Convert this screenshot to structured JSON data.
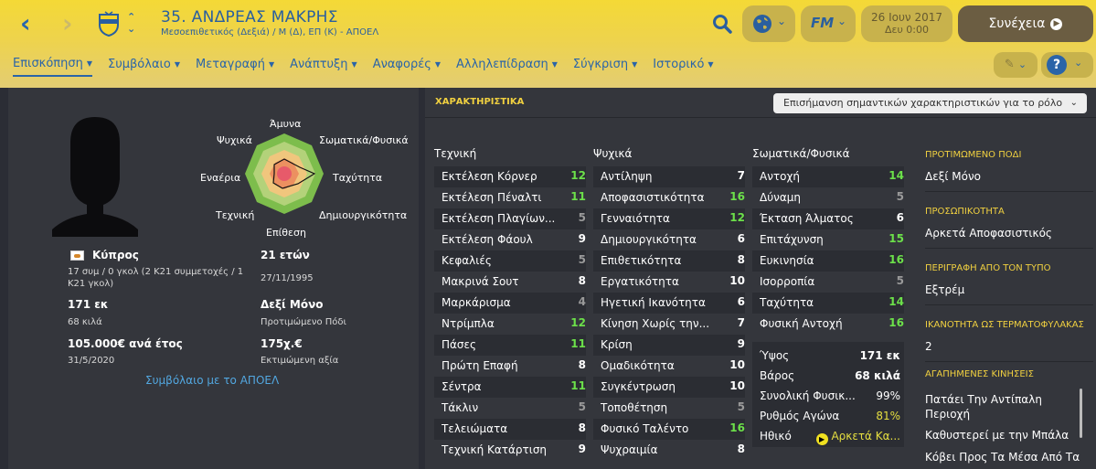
{
  "header": {
    "player_name": "35. ΑΝΔΡΕΑΣ ΜΑΚΡΗΣ",
    "player_desc": "Μεσοεπιθετικός (Δεξιά) / Μ (Δ), ΕΠ (Κ) - ΑΠΟΕΛ",
    "date": "26 Ιουν 2017",
    "time": "Δευ 0:00",
    "continue_label": "Συνέχεια",
    "fm_label": "FM"
  },
  "tabs": [
    {
      "label": "Επισκόπηση"
    },
    {
      "label": "Συμβόλαιο"
    },
    {
      "label": "Μεταγραφή"
    },
    {
      "label": "Ανάπτυξη"
    },
    {
      "label": "Αναφορές"
    },
    {
      "label": "Αλληλεπίδραση"
    },
    {
      "label": "Σύγκριση"
    },
    {
      "label": "Ιστορικό"
    }
  ],
  "radar": {
    "top": "Άμυνα",
    "top_right": "Σωματικά/Φυσικά",
    "right": "Ταχύτητα",
    "bottom_right": "Δημιουργικότητα",
    "bottom": "Επίθεση",
    "bottom_left": "Τεχνική",
    "left": "Εναέρια",
    "top_left": "Ψυχικά"
  },
  "profile": {
    "nation": "Κύπρος",
    "caps": "17 συμ / 0 γκολ (2 Κ21 συμμετοχές / 1 Κ21 γκολ)",
    "age": "21 ετών",
    "dob": "27/11/1995",
    "height": "171 εκ",
    "weight": "68 κιλά",
    "foot": "Δεξί Μόνο",
    "foot_label": "Προτιμώμενο Πόδι",
    "wage": "105.000€ ανά έτος",
    "contract_end": "31/5/2020",
    "value": "175χ.€",
    "value_label": "Εκτιμώμενη αξία",
    "contract_link": "Συμβόλαιο με το ΑΠΟΕΛ"
  },
  "attributes": {
    "title": "ΧΑΡΑΚΤΗΡΙΣΤΙΚΑ",
    "highlight_select": "Επισήμανση σημαντικών χαρακτηριστικών για το ρόλο",
    "technical": {
      "header": "Τεχνική",
      "items": [
        {
          "name": "Εκτέλεση Κόρνερ",
          "value": "12"
        },
        {
          "name": "Εκτέλεση Πέναλτι",
          "value": "11"
        },
        {
          "name": "Εκτέλεση Πλαγίων...",
          "value": "5"
        },
        {
          "name": "Εκτέλεση Φάουλ",
          "value": "9"
        },
        {
          "name": "Κεφαλιές",
          "value": "5"
        },
        {
          "name": "Μακρινά Σουτ",
          "value": "8"
        },
        {
          "name": "Μαρκάρισμα",
          "value": "4"
        },
        {
          "name": "Ντρίμπλα",
          "value": "12"
        },
        {
          "name": "Πάσες",
          "value": "11"
        },
        {
          "name": "Πρώτη Επαφή",
          "value": "8"
        },
        {
          "name": "Σέντρα",
          "value": "11"
        },
        {
          "name": "Τάκλιν",
          "value": "5"
        },
        {
          "name": "Τελειώματα",
          "value": "8"
        },
        {
          "name": "Τεχνική Κατάρτιση",
          "value": "9"
        }
      ]
    },
    "mental": {
      "header": "Ψυχικά",
      "items": [
        {
          "name": "Αντίληψη",
          "value": "7"
        },
        {
          "name": "Αποφασιστικότητα",
          "value": "16"
        },
        {
          "name": "Γενναιότητα",
          "value": "12"
        },
        {
          "name": "Δημιουργικότητα",
          "value": "6"
        },
        {
          "name": "Επιθετικότητα",
          "value": "8"
        },
        {
          "name": "Εργατικότητα",
          "value": "10"
        },
        {
          "name": "Ηγετική Ικανότητα",
          "value": "6"
        },
        {
          "name": "Κίνηση Χωρίς την...",
          "value": "7"
        },
        {
          "name": "Κρίση",
          "value": "9"
        },
        {
          "name": "Ομαδικότητα",
          "value": "10"
        },
        {
          "name": "Συγκέντρωση",
          "value": "10"
        },
        {
          "name": "Τοποθέτηση",
          "value": "5"
        },
        {
          "name": "Φυσικό Ταλέντο",
          "value": "16"
        },
        {
          "name": "Ψυχραιμία",
          "value": "8"
        }
      ]
    },
    "physical": {
      "header": "Σωματικά/Φυσικά",
      "items": [
        {
          "name": "Αντοχή",
          "value": "14"
        },
        {
          "name": "Δύναμη",
          "value": "5"
        },
        {
          "name": "Έκταση Άλματος",
          "value": "6"
        },
        {
          "name": "Επιτάχυνση",
          "value": "15"
        },
        {
          "name": "Ευκινησία",
          "value": "16"
        },
        {
          "name": "Ισορροπία",
          "value": "5"
        },
        {
          "name": "Ταχύτητα",
          "value": "14"
        },
        {
          "name": "Φυσική Αντοχή",
          "value": "16"
        }
      ]
    },
    "misc": {
      "height_label": "Ύψος",
      "height": "171 εκ",
      "weight_label": "Βάρος",
      "weight": "68 κιλά",
      "fitness_label": "Συνολική Φυσικ...",
      "fitness": "99%",
      "match_label": "Ρυθμός Αγώνα",
      "match": "81%",
      "morale_label": "Ηθικό",
      "morale": "Αρκετά Κα..."
    }
  },
  "side": {
    "foot_h": "ΠΡΟΤΙΜΩΜΕΝΟ ΠΟΔΙ",
    "foot": "Δεξί Μόνο",
    "pers_h": "ΠΡΟΣΩΠΙΚΟΤΗΤΑ",
    "pers": "Αρκετά Αποφασιστικός",
    "press_h": "ΠΕΡΙΓΡΑΦΗ ΑΠΟ ΤΟΝ ΤΥΠΟ",
    "press": "Εξτρέμ",
    "gk_h": "ΙΚΑΝΟΤΗΤΑ ΩΣ ΤΕΡΜΑΤΟΦΥΛΑΚΑΣ",
    "gk": "2",
    "moves_h": "ΑΓΑΠΗΜΕΝΕΣ ΚΙΝΗΣΕΙΣ",
    "moves": [
      "Πατάει Την Αντίπαλη",
      "Περιοχή",
      "Καθυστερεί με την Μπάλα",
      "Κόβει Προς Τα Μέσα Από Τα"
    ]
  },
  "colors": {
    "header_yellow": "#f4d936",
    "accent_blue": "#2a64a8",
    "green_attr": "#6ce04a",
    "panel": "#34363c"
  }
}
